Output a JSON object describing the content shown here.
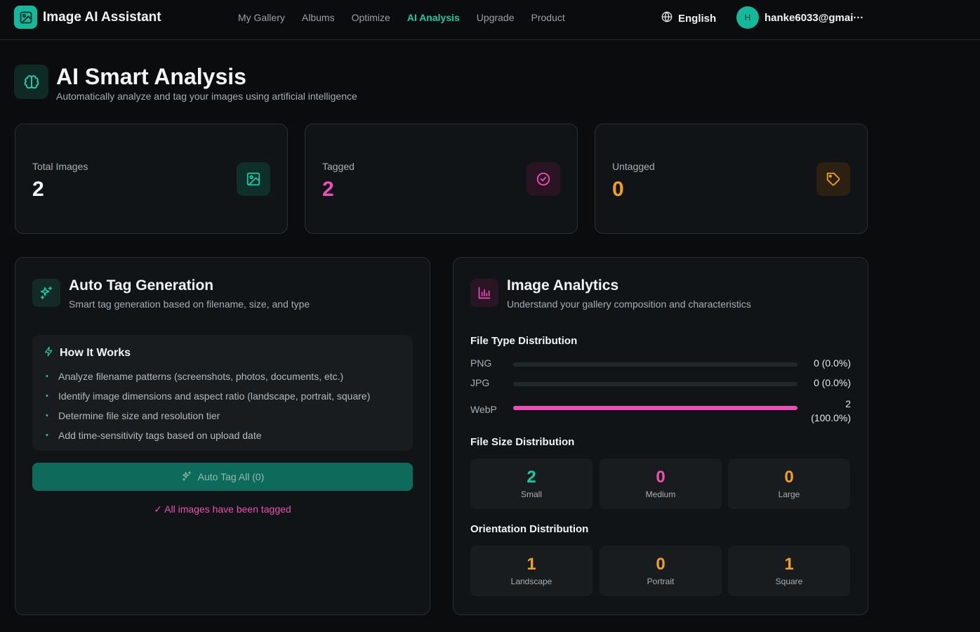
{
  "app": {
    "name": "Image AI Assistant",
    "nav": [
      "My Gallery",
      "Albums",
      "Optimize",
      "AI Analysis",
      "Upgrade",
      "Product"
    ],
    "active_nav": "AI Analysis",
    "language": "English",
    "user_initial": "H",
    "user_email": "hanke6033@gmai···"
  },
  "page": {
    "title": "AI Smart Analysis",
    "subtitle": "Automatically analyze and tag your images using artificial intelligence"
  },
  "stats": {
    "total": {
      "label": "Total Images",
      "value": "2",
      "icon": "image-icon"
    },
    "tagged": {
      "label": "Tagged",
      "value": "2",
      "icon": "check-circle-icon"
    },
    "untagged": {
      "label": "Untagged",
      "value": "0",
      "icon": "tag-icon"
    }
  },
  "auto_tag": {
    "title": "Auto Tag Generation",
    "subtitle": "Smart tag generation based on filename, size, and type",
    "how_title": "How It Works",
    "how_items": [
      "Analyze filename patterns (screenshots, photos, documents, etc.)",
      "Identify image dimensions and aspect ratio (landscape, portrait, square)",
      "Determine file size and resolution tier",
      "Add time-sensitivity tags based on upload date"
    ],
    "button_label": "Auto Tag All (0)",
    "status_message": "✓ All images have been tagged"
  },
  "analytics": {
    "title": "Image Analytics",
    "subtitle": "Understand your gallery composition and characteristics",
    "file_type_title": "File Type Distribution",
    "file_types": [
      {
        "label": "PNG",
        "count": "0 (0.0%)",
        "fraction": 0.0
      },
      {
        "label": "JPG",
        "count": "0 (0.0%)",
        "fraction": 0.0
      },
      {
        "label": "WebP",
        "count": "2",
        "count_line2": "(100.0%)",
        "fraction": 1.0
      }
    ],
    "file_size_title": "File Size Distribution",
    "file_sizes": [
      {
        "label": "Small",
        "value": "2"
      },
      {
        "label": "Medium",
        "value": "0"
      },
      {
        "label": "Large",
        "value": "0"
      }
    ],
    "orientation_title": "Orientation Distribution",
    "orientations": [
      {
        "label": "Landscape",
        "value": "1"
      },
      {
        "label": "Portrait",
        "value": "0"
      },
      {
        "label": "Square",
        "value": "1"
      }
    ]
  },
  "colors": {
    "accent": "#1fc8a6",
    "pink": "#ec4fb4",
    "amber": "#f0a020"
  }
}
